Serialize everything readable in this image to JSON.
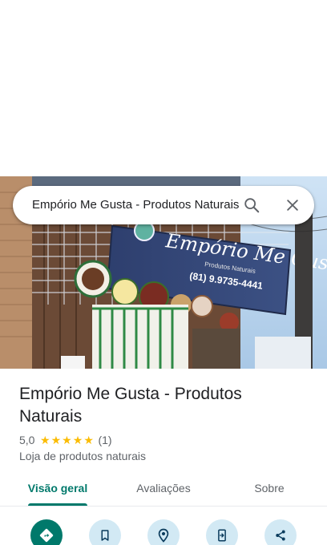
{
  "search": {
    "query": "Empório Me Gusta - Produtos Naturais",
    "search_icon": "search-icon",
    "close_icon": "close-icon"
  },
  "photo": {
    "sign_text": "Empório Me Gusta",
    "sign_subtext": "Produtos Naturais",
    "phone": "(81) 9.9735-4441"
  },
  "place": {
    "name": "Empório Me Gusta - Produtos Naturais",
    "rating": "5,0",
    "stars": 5,
    "review_count": "(1)",
    "category": "Loja de produtos naturais"
  },
  "tabs": [
    {
      "label": "Visão geral",
      "active": true
    },
    {
      "label": "Avaliações",
      "active": false
    },
    {
      "label": "Sobre",
      "active": false
    }
  ],
  "actions": [
    {
      "icon": "directions-icon"
    },
    {
      "icon": "save-bookmark-icon"
    },
    {
      "icon": "nearby-icon"
    },
    {
      "icon": "send-to-phone-icon"
    },
    {
      "icon": "share-icon"
    }
  ],
  "colors": {
    "accent": "#00796b",
    "action_bg": "#d2e9f4",
    "star": "#fbbc04",
    "secondary_text": "#5f6368"
  }
}
